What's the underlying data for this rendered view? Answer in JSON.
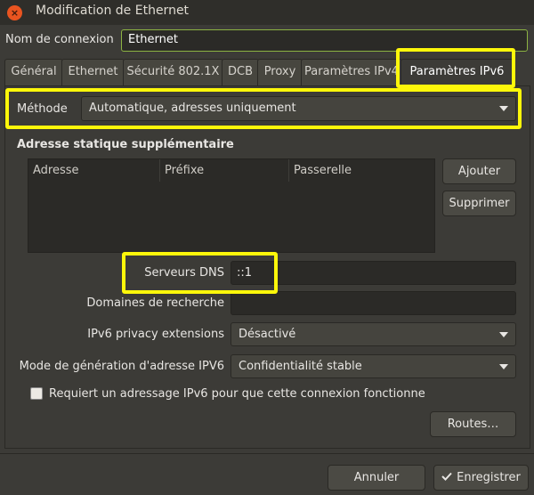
{
  "window": {
    "title": "Modification de Ethernet",
    "close_glyph": "×"
  },
  "connection": {
    "label": "Nom de connexion",
    "value": "Ethernet"
  },
  "tabs": [
    {
      "label": "Général",
      "active": false
    },
    {
      "label": "Ethernet",
      "active": false
    },
    {
      "label": "Sécurité 802.1X",
      "active": false
    },
    {
      "label": "DCB",
      "active": false
    },
    {
      "label": "Proxy",
      "active": false
    },
    {
      "label": "Paramètres IPv4",
      "active": false
    },
    {
      "label": "Paramètres IPv6",
      "active": true
    }
  ],
  "ipv6": {
    "method_label": "Méthode",
    "method_value": "Automatique, adresses uniquement",
    "static_title": "Adresse statique supplémentaire",
    "table_headers": [
      "Adresse",
      "Préfixe",
      "Passerelle"
    ],
    "add_label": "Ajouter",
    "delete_label": "Supprimer",
    "dns_label": "Serveurs DNS",
    "dns_value": "::1",
    "domains_label": "Domaines de recherche",
    "domains_value": "",
    "privacy_label": "IPv6 privacy extensions",
    "privacy_value": "Désactivé",
    "gen_mode_label": "Mode de génération d'adresse IPV6",
    "gen_mode_value": "Confidentialité stable",
    "require_label": "Requiert un adressage IPv6 pour que cette connexion fonctionne",
    "require_checked": false,
    "routes_label": "Routes…"
  },
  "footer": {
    "cancel_label": "Annuler",
    "save_label": "Enregistrer",
    "save_icon": "check-icon"
  },
  "colors": {
    "accent_focus": "#8cb342",
    "highlight": "#fdf70a",
    "close_button": "#e95420",
    "window_bg": "#3c3b37"
  }
}
